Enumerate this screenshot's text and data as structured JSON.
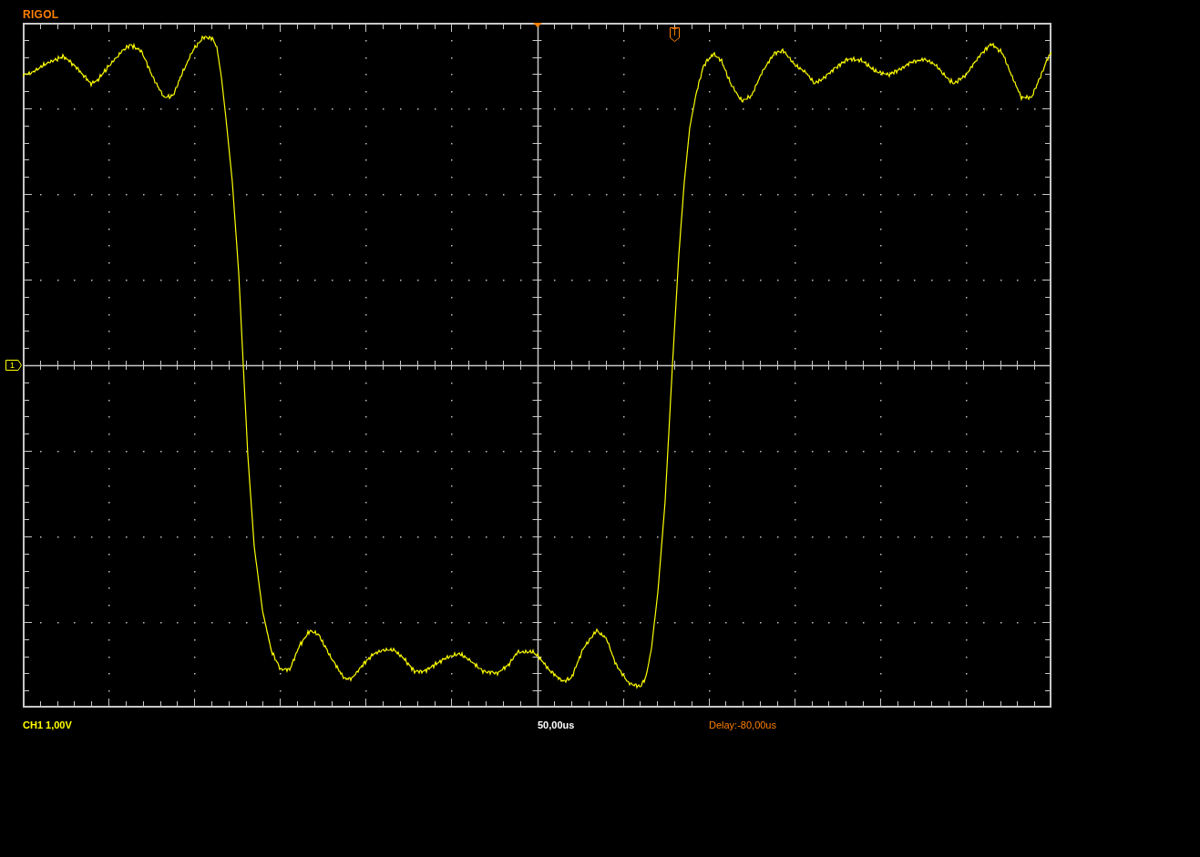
{
  "logo": {
    "text": "RIGOL"
  },
  "screen": {
    "channel_marker": {
      "label": "1"
    },
    "trigger_level_marker": {
      "label": "T"
    }
  },
  "status_bar": {
    "channel_scale": "CH1 1,00V",
    "timebase": "50,00us",
    "delay": "Delay:-80,00us"
  }
}
